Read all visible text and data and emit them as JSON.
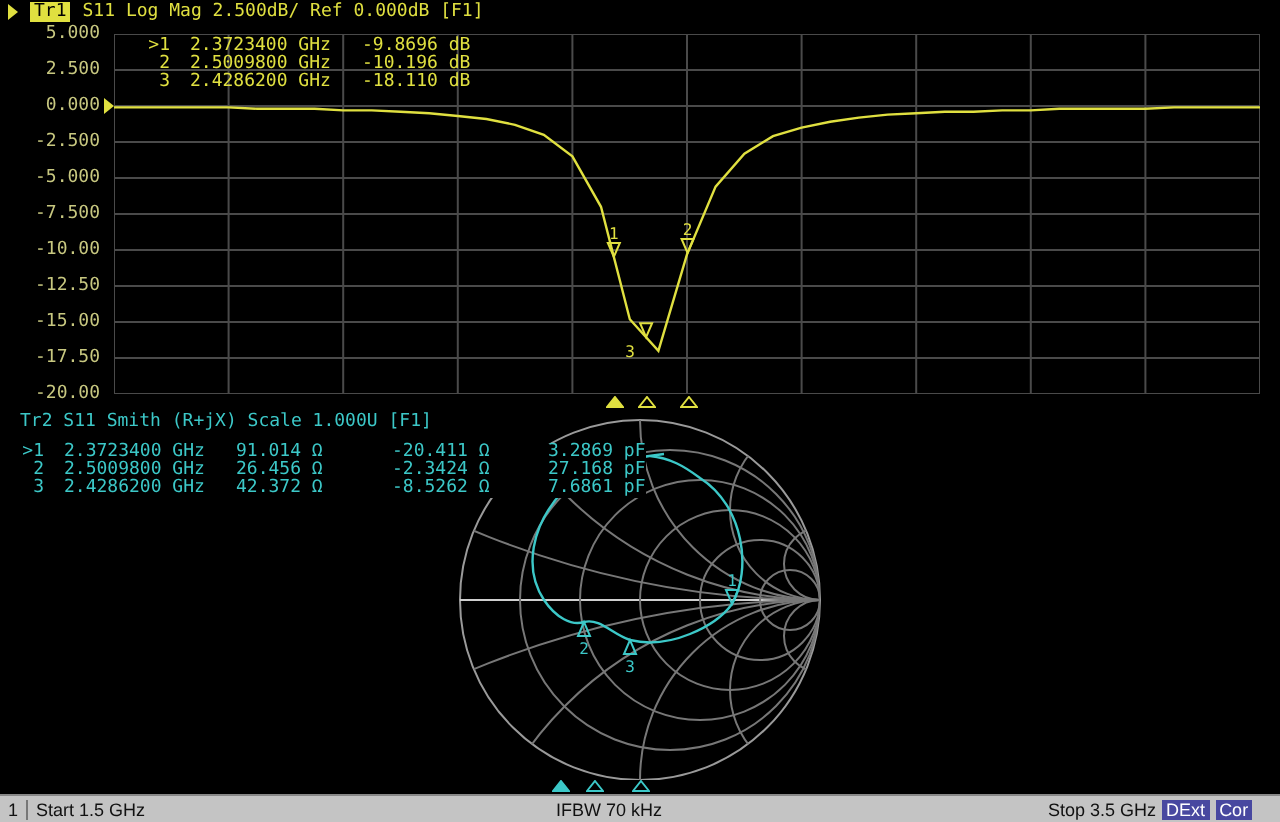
{
  "trace1": {
    "label": "Tr1",
    "title": "S11 Log Mag 2.500dB/ Ref 0.000dB [F1]",
    "markers": [
      {
        "label": ">1",
        "frequency": "2.3723400 GHz",
        "value": "-9.8696 dB",
        "tag": "1",
        "selected": true
      },
      {
        "label": "2",
        "frequency": "2.5009800 GHz",
        "value": "-10.196 dB",
        "tag": "2",
        "selected": false
      },
      {
        "label": "3",
        "frequency": "2.4286200 GHz",
        "value": "-18.110 dB",
        "tag": "3",
        "selected": false
      }
    ],
    "chart_data": {
      "type": "line",
      "grid": true,
      "categories": [
        null,
        null,
        null,
        null,
        null,
        null,
        null,
        null,
        null,
        null,
        null,
        null,
        null,
        null,
        null,
        null,
        null,
        null,
        null,
        null,
        null,
        null,
        null,
        null,
        null,
        null,
        null,
        null,
        null,
        null,
        null,
        null,
        null,
        null,
        null,
        null,
        null,
        null,
        null,
        null,
        null
      ],
      "ylim": [
        -20,
        5
      ],
      "yticks": [
        {
          "value": 5,
          "label": "5.000"
        },
        {
          "value": 2.5,
          "label": "2.500"
        },
        {
          "value": 0,
          "label": "0.000"
        },
        {
          "value": -2.5,
          "label": "-2.500"
        },
        {
          "value": -5,
          "label": "-5.000"
        },
        {
          "value": -7.5,
          "label": "-7.500"
        },
        {
          "value": -10,
          "label": "-10.00"
        },
        {
          "value": -12.5,
          "label": "-12.50"
        },
        {
          "value": -15,
          "label": "-15.00"
        },
        {
          "value": -17.5,
          "label": "-17.50"
        },
        {
          "value": -20,
          "label": "-20.00"
        }
      ],
      "series": [
        {
          "color": "#e0e040",
          "values": [
            -0.1,
            -0.1,
            -0.1,
            -0.1,
            -0.1,
            -0.2,
            -0.2,
            -0.2,
            -0.3,
            -0.3,
            -0.4,
            -0.5,
            -0.7,
            -0.9,
            -1.3,
            -2.0,
            -3.5,
            -7.0,
            -14.8,
            -17.0,
            -10.3,
            -5.6,
            -3.3,
            -2.1,
            -1.5,
            -1.1,
            -0.8,
            -0.6,
            -0.5,
            -0.4,
            -0.4,
            -0.3,
            -0.3,
            -0.2,
            -0.2,
            -0.2,
            -0.2,
            -0.1,
            -0.1,
            -0.1,
            -0.1
          ]
        }
      ]
    }
  },
  "trace2": {
    "title": "Tr2 S11 Smith (R+jX) Scale 1.000U [F1]",
    "markers": [
      {
        "label": ">1",
        "frequency": "2.3723400 GHz",
        "resistance": "91.014 Ω",
        "reactance": "-20.411 Ω",
        "component": "3.2869 pF",
        "tag": "1",
        "selected": true
      },
      {
        "label": "2",
        "frequency": "2.5009800 GHz",
        "resistance": "26.456 Ω",
        "reactance": "-2.3424 Ω",
        "component": "27.168 pF",
        "tag": "2",
        "selected": false
      },
      {
        "label": "3",
        "frequency": "2.4286200 GHz",
        "resistance": "42.372 Ω",
        "reactance": "-8.5262 Ω",
        "component": "7.6861 pF",
        "tag": "3",
        "selected": false
      }
    ]
  },
  "status_bar": {
    "channel": "1",
    "start": "Start 1.5 GHz",
    "ifbw": "IFBW 70 kHz",
    "stop": "Stop 3.5 GHz",
    "badges": [
      "DExt",
      "Cor"
    ]
  }
}
